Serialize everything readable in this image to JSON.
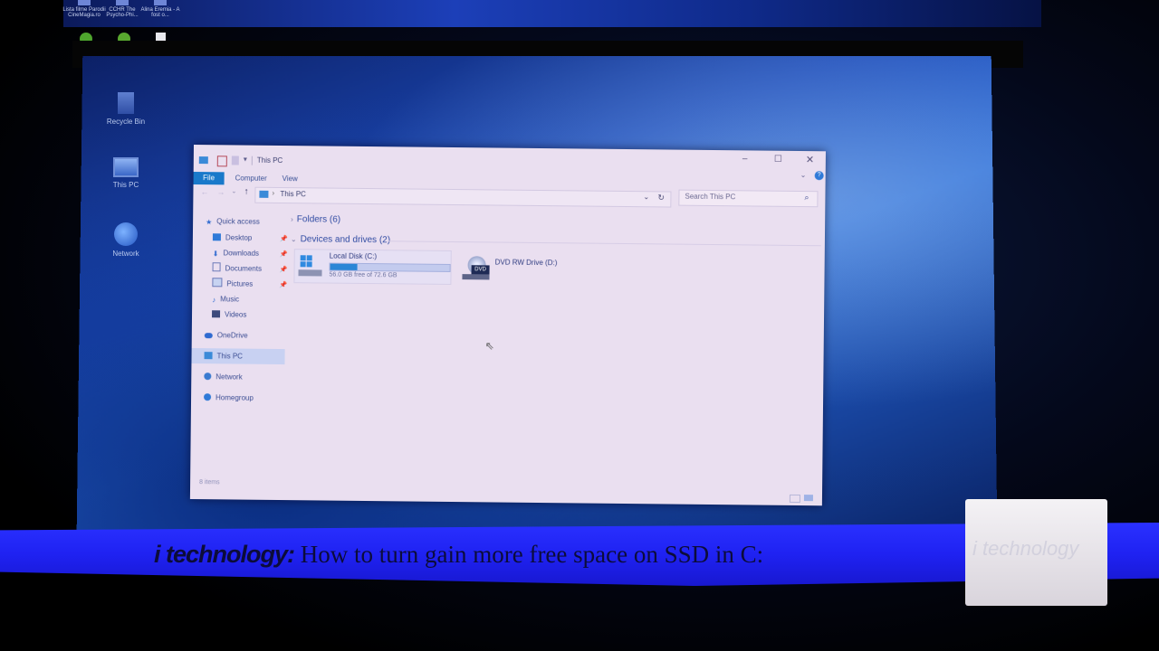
{
  "desktop": {
    "top_icons": [
      {
        "label": "Lista filme Parodii CineMagia.ro"
      },
      {
        "label": "CCHR The Psycho-Phi..."
      },
      {
        "label": "Alina Eremia - A fost o..."
      }
    ],
    "icons": [
      {
        "label": "Recycle Bin",
        "icon": "recycle-bin-icon"
      },
      {
        "label": "This PC",
        "icon": "computer-icon"
      },
      {
        "label": "Network",
        "icon": "network-icon"
      }
    ]
  },
  "window": {
    "title": "This PC",
    "controls": {
      "minimize": "–",
      "maximize": "☐",
      "close": "✕"
    },
    "ribbon_tabs": [
      "File",
      "Computer",
      "View"
    ],
    "address": {
      "path": "This PC"
    },
    "search": {
      "placeholder": "Search This PC"
    },
    "nav": [
      {
        "label": "Quick access",
        "icon": "star-icon"
      },
      {
        "label": "Desktop",
        "icon": "desktop-icon",
        "pinned": true
      },
      {
        "label": "Downloads",
        "icon": "download-icon",
        "pinned": true
      },
      {
        "label": "Documents",
        "icon": "documents-icon",
        "pinned": true
      },
      {
        "label": "Pictures",
        "icon": "pictures-icon",
        "pinned": true
      },
      {
        "label": "Music",
        "icon": "music-icon"
      },
      {
        "label": "Videos",
        "icon": "videos-icon"
      },
      {
        "label": "OneDrive",
        "icon": "cloud-icon"
      },
      {
        "label": "This PC",
        "icon": "computer-icon",
        "selected": true
      },
      {
        "label": "Network",
        "icon": "network-icon"
      },
      {
        "label": "Homegroup",
        "icon": "homegroup-icon"
      }
    ],
    "groups": {
      "folders": "Folders (6)",
      "devices": "Devices and drives (2)"
    },
    "drives": [
      {
        "name": "Local Disk (C:)",
        "free_text": "56.0 GB free of 72.6 GB",
        "used_fraction": 0.23,
        "icon": "hard-drive-icon"
      },
      {
        "name": "DVD RW Drive (D:)",
        "icon": "dvd-drive-icon",
        "dvd_label": "DVD"
      }
    ],
    "status": "8 items"
  },
  "banner": {
    "brand": "i technology:",
    "text": "How to turn gain more free space on SSD in C:"
  },
  "logo": {
    "text": "i technology"
  },
  "colors": {
    "accent": "#1979ca",
    "banner": "#2328f5"
  }
}
